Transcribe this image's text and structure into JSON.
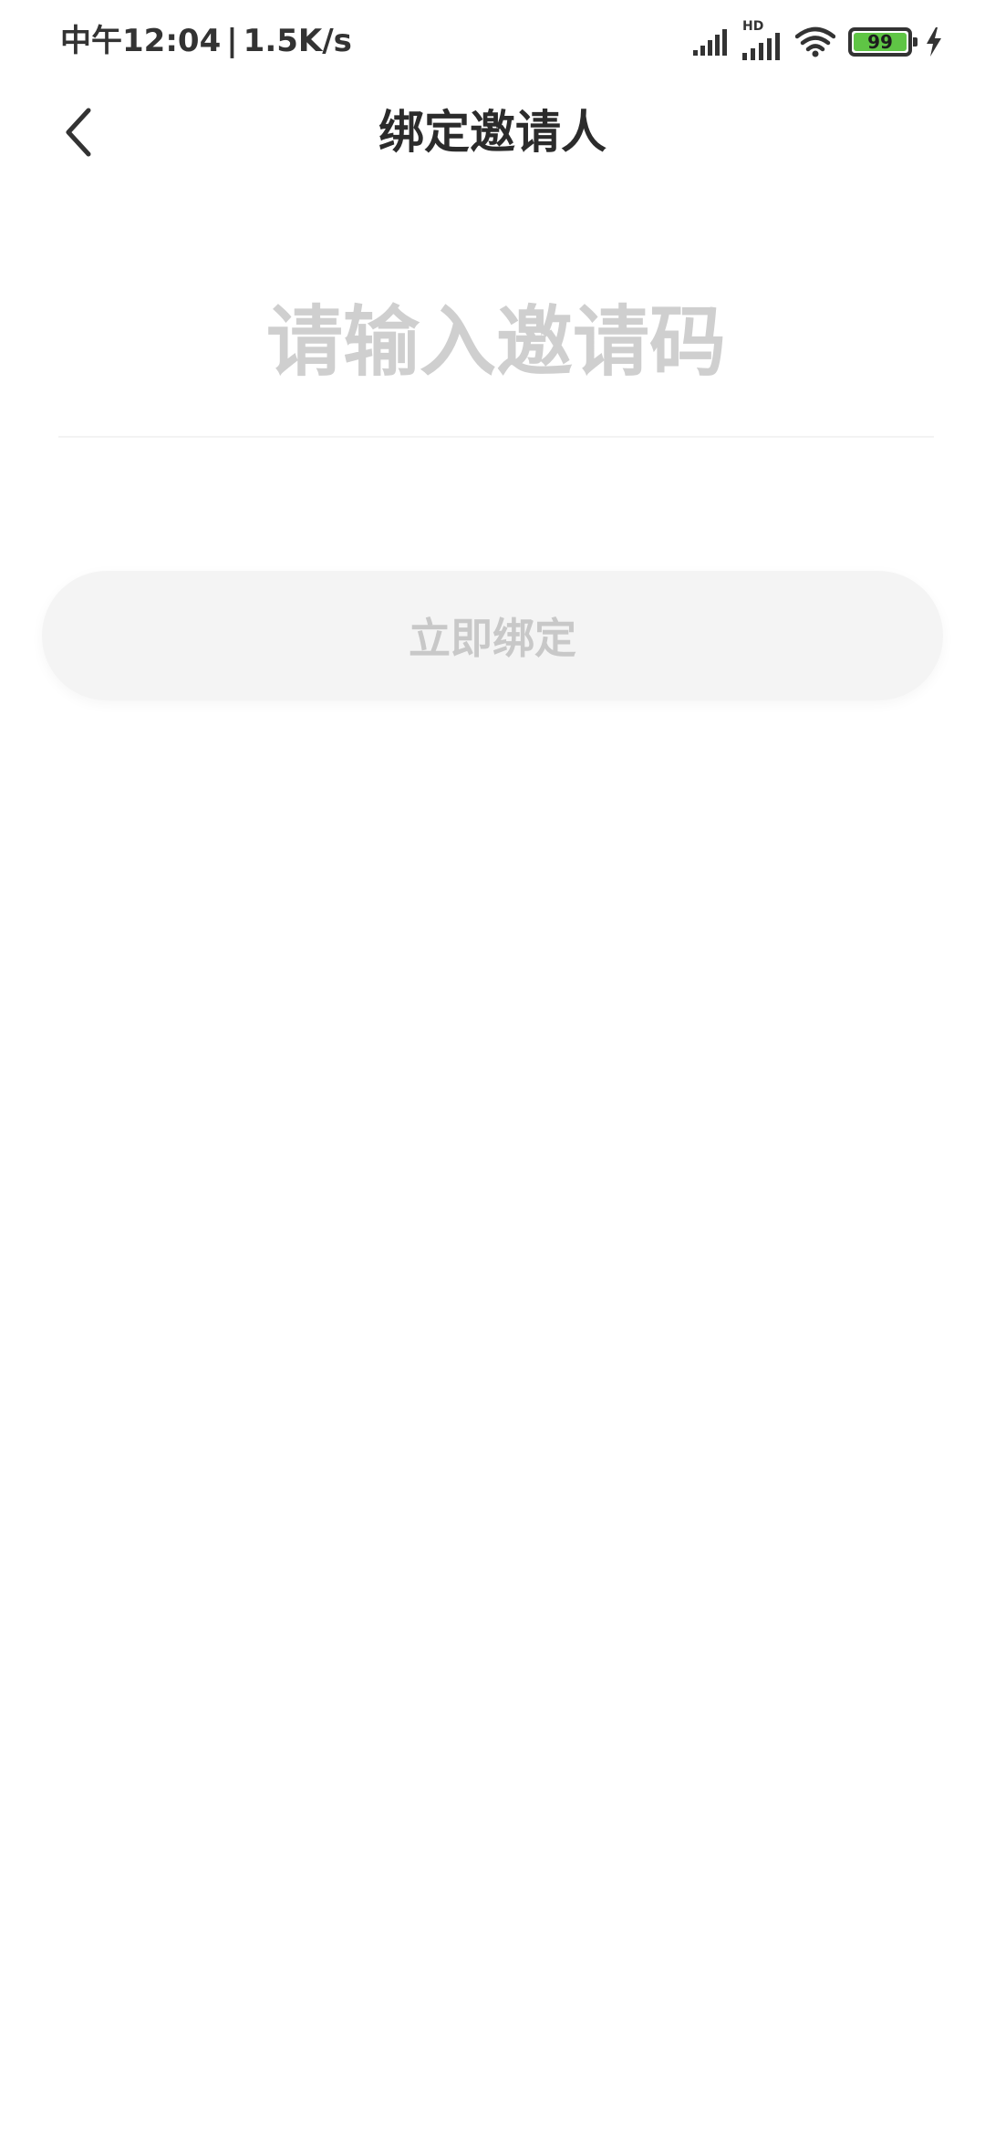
{
  "status_bar": {
    "time": "中午12:04",
    "separator": "|",
    "net_speed": "1.5K/s",
    "signal_label": "HD",
    "battery_level": "99",
    "battery_color": "#5fc545",
    "icons": [
      "cell-signal-icon",
      "hd-cell-signal-icon",
      "wifi-icon",
      "battery-icon",
      "charging-bolt-icon"
    ]
  },
  "nav": {
    "title": "绑定邀请人",
    "back_icon": "chevron-left-icon"
  },
  "form": {
    "invite_code": {
      "value": "",
      "placeholder": "请输入邀请码"
    },
    "bind_button_label": "立即绑定"
  },
  "colors": {
    "title": "#2b2b2b",
    "placeholder": "#cfcfcf",
    "button_bg": "#f4f4f4",
    "button_text": "#c8c8c8",
    "divider": "#f3f3f3"
  }
}
